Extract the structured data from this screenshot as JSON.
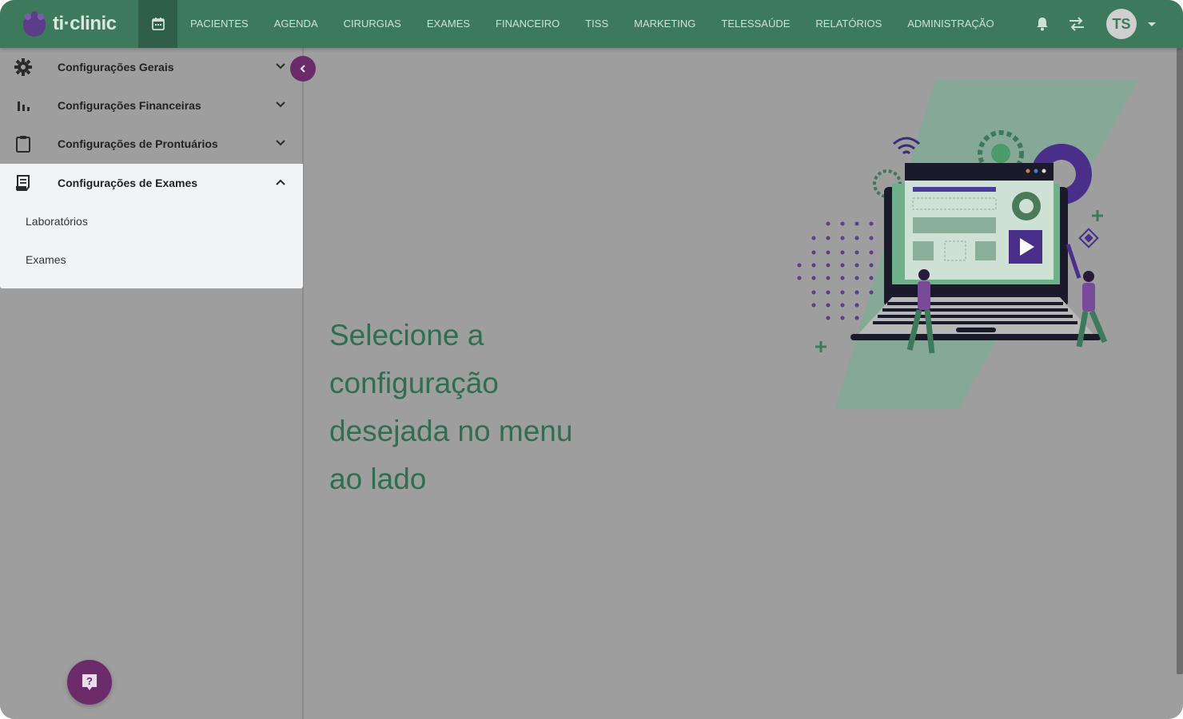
{
  "app": {
    "logo_text": "ti·clinic"
  },
  "nav": {
    "items": [
      "PACIENTES",
      "AGENDA",
      "CIRURGIAS",
      "EXAMES",
      "FINANCEIRO",
      "TISS",
      "MARKETING",
      "TELESSAÚDE",
      "RELATÓRIOS",
      "ADMINISTRAÇÃO"
    ]
  },
  "user": {
    "initials": "TS"
  },
  "sidebar": {
    "items": [
      {
        "label": "Configurações Gerais",
        "icon": "gear-icon",
        "expanded": false
      },
      {
        "label": "Configurações Financeiras",
        "icon": "bar-chart-icon",
        "expanded": false
      },
      {
        "label": "Configurações de Prontuários",
        "icon": "clipboard-icon",
        "expanded": false
      },
      {
        "label": "Configurações de Exames",
        "icon": "receipt-icon",
        "expanded": true,
        "children": [
          "Laboratórios",
          "Exames"
        ]
      }
    ]
  },
  "main": {
    "message": [
      "Selecione a",
      "configuração",
      "desejada no menu",
      "ao lado"
    ]
  },
  "colors": {
    "topbar": "#3d7a5c",
    "accent_purple": "#6b2b6a",
    "text_green": "#2f6e50",
    "overlay": "#9e9e9e"
  }
}
